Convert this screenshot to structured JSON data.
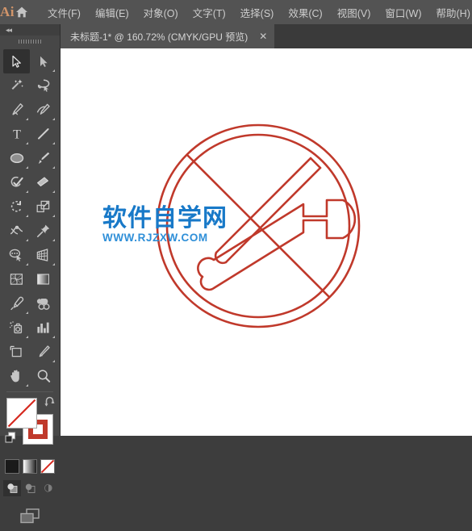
{
  "app": {
    "logo_text": "Ai",
    "logo_color": "#d2956a",
    "home_icon": "home-icon"
  },
  "menubar": {
    "items": [
      {
        "label": "文件(F)",
        "name": "menu-file"
      },
      {
        "label": "编辑(E)",
        "name": "menu-edit"
      },
      {
        "label": "对象(O)",
        "name": "menu-object"
      },
      {
        "label": "文字(T)",
        "name": "menu-type"
      },
      {
        "label": "选择(S)",
        "name": "menu-select"
      },
      {
        "label": "效果(C)",
        "name": "menu-effect"
      },
      {
        "label": "视图(V)",
        "name": "menu-view"
      },
      {
        "label": "窗口(W)",
        "name": "menu-window"
      },
      {
        "label": "帮助(H)",
        "name": "menu-help"
      }
    ]
  },
  "tabbar": {
    "document_title": "未标题-1* @ 160.72% (CMYK/GPU 预览)",
    "close_label": "✕",
    "document_name": "未标题-1",
    "modified": true,
    "zoom_level": "160.72%",
    "color_mode": "CMYK",
    "preview_mode": "GPU 预览"
  },
  "toolbar": {
    "collapse_label": "◂◂",
    "tools": [
      {
        "name": "selection-tool",
        "label": "选择工具",
        "active": true,
        "has_flyout": false
      },
      {
        "name": "direct-selection-tool",
        "label": "直接选择工具",
        "active": false,
        "has_flyout": true
      },
      {
        "name": "magic-wand-tool",
        "label": "魔棒工具",
        "active": false,
        "has_flyout": false
      },
      {
        "name": "lasso-tool",
        "label": "套索工具",
        "active": false,
        "has_flyout": false
      },
      {
        "name": "pen-tool",
        "label": "钢笔工具",
        "active": false,
        "has_flyout": true
      },
      {
        "name": "curvature-tool",
        "label": "曲率工具",
        "active": false,
        "has_flyout": true
      },
      {
        "name": "type-tool",
        "label": "文字工具",
        "active": false,
        "has_flyout": true
      },
      {
        "name": "line-segment-tool",
        "label": "直线段工具",
        "active": false,
        "has_flyout": true
      },
      {
        "name": "ellipse-tool",
        "label": "椭圆工具",
        "active": false,
        "has_flyout": true
      },
      {
        "name": "paintbrush-tool",
        "label": "画笔工具",
        "active": false,
        "has_flyout": true
      },
      {
        "name": "shaper-tool",
        "label": "Shaper 工具",
        "active": false,
        "has_flyout": true
      },
      {
        "name": "eraser-tool",
        "label": "橡皮擦工具",
        "active": false,
        "has_flyout": true
      },
      {
        "name": "rotate-tool",
        "label": "旋转工具",
        "active": false,
        "has_flyout": true
      },
      {
        "name": "scale-tool",
        "label": "比例缩放工具",
        "active": false,
        "has_flyout": true
      },
      {
        "name": "width-tool",
        "label": "宽度工具",
        "active": false,
        "has_flyout": true
      },
      {
        "name": "free-transform-tool",
        "label": "自由变换工具",
        "active": false,
        "has_flyout": true
      },
      {
        "name": "shape-builder-tool",
        "label": "形状生成器工具",
        "active": false,
        "has_flyout": true
      },
      {
        "name": "perspective-grid-tool",
        "label": "透视网格工具",
        "active": false,
        "has_flyout": true
      },
      {
        "name": "mesh-tool",
        "label": "网格工具",
        "active": false,
        "has_flyout": false
      },
      {
        "name": "gradient-tool",
        "label": "渐变工具",
        "active": false,
        "has_flyout": false
      },
      {
        "name": "eyedropper-tool",
        "label": "吸管工具",
        "active": false,
        "has_flyout": true
      },
      {
        "name": "blend-tool",
        "label": "混合工具",
        "active": false,
        "has_flyout": false
      },
      {
        "name": "symbol-sprayer-tool",
        "label": "符号喷枪工具",
        "active": false,
        "has_flyout": true
      },
      {
        "name": "column-graph-tool",
        "label": "柱形图工具",
        "active": false,
        "has_flyout": true
      },
      {
        "name": "artboard-tool",
        "label": "画板工具",
        "active": false,
        "has_flyout": false
      },
      {
        "name": "slice-tool",
        "label": "切片工具",
        "active": false,
        "has_flyout": true
      },
      {
        "name": "hand-tool",
        "label": "抓手工具",
        "active": false,
        "has_flyout": true
      },
      {
        "name": "zoom-tool",
        "label": "缩放工具",
        "active": false,
        "has_flyout": false
      }
    ],
    "fill_stroke": {
      "fill_label": "填色",
      "fill_value": "无",
      "stroke_label": "描边",
      "stroke_color": "#c0392b",
      "swap_label": "互换填色和描边",
      "default_label": "默认填色和描边"
    },
    "color_modes": [
      {
        "name": "color-mode-button",
        "label": "颜色",
        "active": false
      },
      {
        "name": "gradient-mode-button",
        "label": "渐变",
        "active": false
      },
      {
        "name": "none-mode-button",
        "label": "无",
        "active": true
      }
    ],
    "draw_modes": [
      {
        "name": "draw-normal-button",
        "label": "正常绘图",
        "active": true
      },
      {
        "name": "draw-behind-button",
        "label": "背面绘图",
        "active": false
      },
      {
        "name": "draw-inside-button",
        "label": "内部绘图",
        "active": false
      }
    ],
    "screen_mode": {
      "name": "change-screen-mode-button",
      "label": "更改屏幕模式"
    }
  },
  "canvas": {
    "background": "#ffffff",
    "artwork": {
      "name": "no-tools-prohibition-sign",
      "stroke_color": "#c0392b",
      "description": "禁止标志 — 交叉的扳手与螺丝刀"
    },
    "watermark": {
      "cn_text": "软件自学网",
      "url_text": "WWW.RJZXW.COM",
      "cn_color": "#1879c8",
      "url_color": "#2f8fd8"
    }
  }
}
